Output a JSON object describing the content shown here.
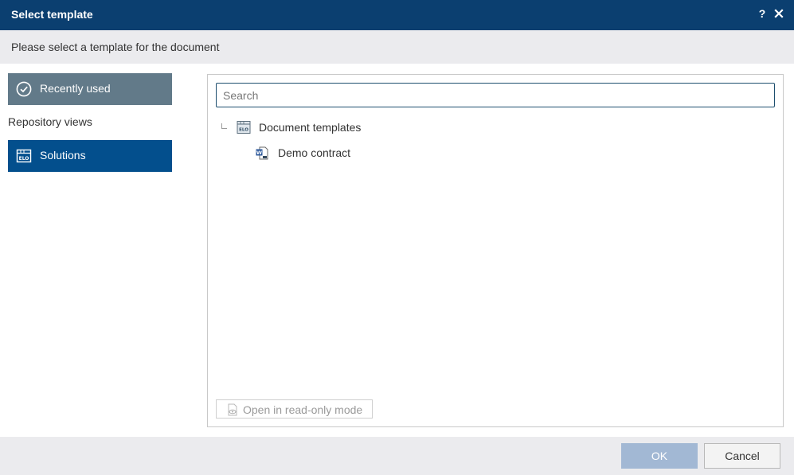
{
  "dialog": {
    "title": "Select template",
    "help_glyph": "?",
    "subtitle": "Please select a template for the document"
  },
  "sidebar": {
    "recently_used": {
      "label": "Recently used",
      "icon": "check-circle-icon"
    },
    "section_label": "Repository views",
    "solutions": {
      "label": "Solutions",
      "icon": "elo-repository-icon"
    }
  },
  "main": {
    "search": {
      "placeholder": "Search",
      "value": ""
    },
    "tree": {
      "root": {
        "label": "Document templates",
        "icon": "elo-folder-icon"
      },
      "children": [
        {
          "label": "Demo contract",
          "icon": "word-document-icon"
        }
      ]
    },
    "readonly_button": {
      "label": "Open in read-only mode",
      "icon": "read-only-eye-icon"
    }
  },
  "footer": {
    "ok_label": "OK",
    "cancel_label": "Cancel"
  },
  "colors": {
    "titlebar": "#0b3f70",
    "recent_button": "#627a89",
    "solutions_button": "#034f8d",
    "ok_disabled": "#a2b8d4",
    "panel_bg": "#ebebee"
  }
}
